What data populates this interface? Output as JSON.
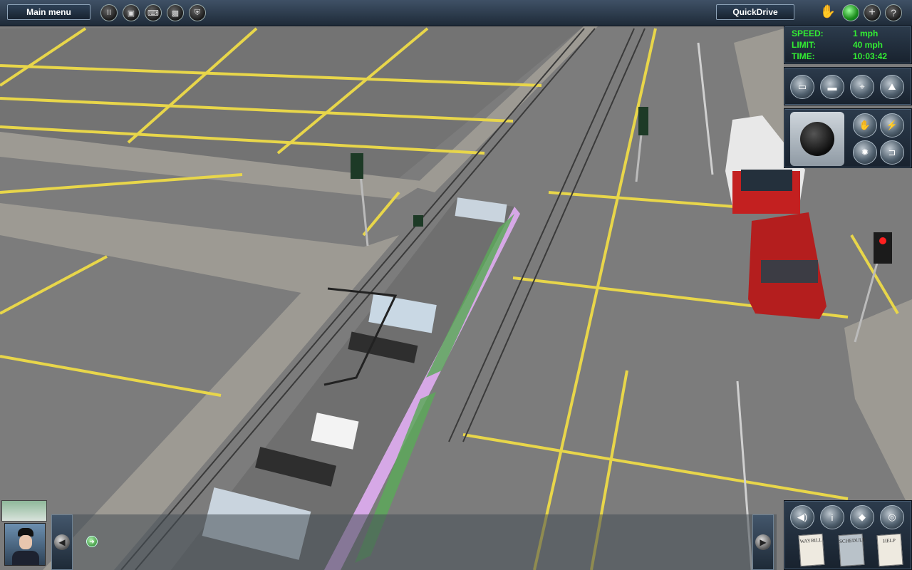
{
  "topbar": {
    "main_menu_label": "Main menu",
    "quickdrive_label": "QuickDrive",
    "left_icons": [
      "pause-icon",
      "save-icon",
      "keyboard-icon",
      "map-icon",
      "shield-icon"
    ],
    "right_icons": [
      "driver-icon",
      "status-light-icon",
      "add-icon",
      "help-icon"
    ]
  },
  "info": {
    "speed_label": "SPEED:",
    "speed_value": "1 mph",
    "limit_label": "LIMIT:",
    "limit_value": "40 mph",
    "time_label": "TIME:",
    "time_value": "10:03:42"
  },
  "camera_panel": {
    "icons": [
      "cab-camera-icon",
      "external-camera-icon",
      "tripod-camera-icon",
      "free-camera-icon"
    ]
  },
  "control_panel": {
    "icons": [
      "direction-dial-icon",
      "hand-brake-icon",
      "lightning-icon",
      "light-icon",
      "coupler-icon"
    ]
  },
  "bottom_panel": {
    "icons": [
      "sound-icon",
      "info-icon",
      "diamond-nav-icon",
      "eye-icon"
    ],
    "doc_labels": [
      "WAYBILL",
      "SCHEDULE",
      "HELP"
    ]
  },
  "colors": {
    "ground": "#7a7a7a",
    "road_line": "#e8d64a",
    "tram_body": "#d6a8e6",
    "info_text": "#33ee33",
    "panel_bg": "#1e2a38"
  }
}
